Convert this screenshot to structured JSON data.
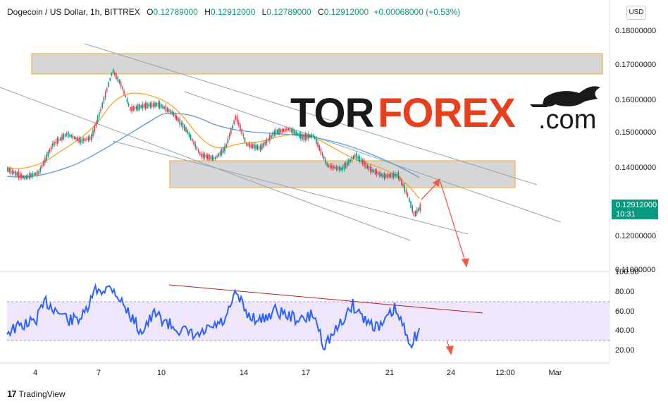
{
  "header": {
    "symbol": "Dogecoin / US Dollar, 1h, BITTREX",
    "open_label": "O",
    "open": "0.12789000",
    "high_label": "H",
    "high": "0.12912000",
    "low_label": "L",
    "low": "0.12789000",
    "close_label": "C",
    "close": "0.12912000",
    "change": "+0.00068000 (+0.53%)"
  },
  "currency_button": "USD",
  "price_axis": [
    "0.18000000",
    "0.17000000",
    "0.16000000",
    "0.15000000",
    "0.14000000",
    "0.12000000",
    "0.11000000"
  ],
  "last_price": {
    "value": "0.12912000",
    "countdown": "10:31"
  },
  "rsi_axis": [
    "100.00",
    "80.00",
    "60.00",
    "40.00",
    "20.00"
  ],
  "time_axis": [
    "4",
    "7",
    "10",
    "14",
    "17",
    "21",
    "24",
    "12:00",
    "Mar"
  ],
  "logo": {
    "part1": "TOR",
    "part2": "FOREX",
    "part3": ".com"
  },
  "footer": {
    "brand": "TradingView"
  },
  "colors": {
    "up": "#089981",
    "rsi_line": "#2962ff",
    "ema_fast": "#f5a623",
    "ema_slow": "#5b9bd5",
    "trendline": "#8ea6b8",
    "rsi_trend": "#b22222",
    "arrow": "#f05a4a",
    "logo_dark": "#1a1a1a",
    "logo_red": "#e8401c"
  },
  "chart_data": {
    "type": "candlestick",
    "title": "Dogecoin / US Dollar, 1h, BITTREX",
    "ylim": [
      0.11,
      0.185
    ],
    "resistance_zones": [
      [
        0.167,
        0.173
      ],
      [
        0.1345,
        0.1415
      ]
    ],
    "last_close": 0.12912,
    "rsi": {
      "ylim": [
        10,
        100
      ],
      "band": [
        30,
        70
      ]
    }
  }
}
